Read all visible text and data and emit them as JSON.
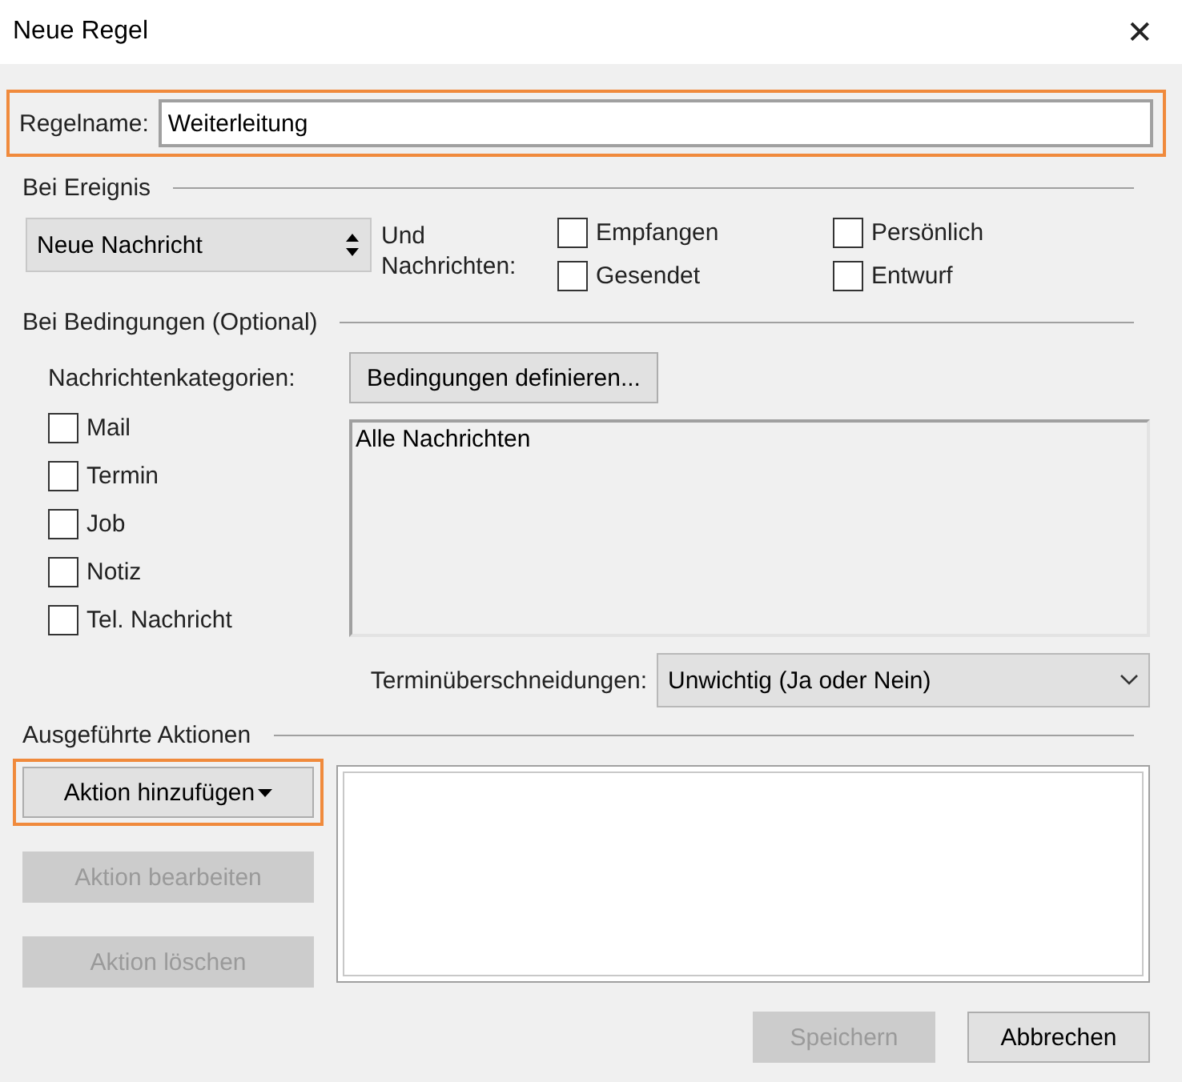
{
  "window": {
    "title": "Neue Regel",
    "close": "✕"
  },
  "rule_name": {
    "label": "Regelname:",
    "value": "Weiterleitung",
    "highlighted": true
  },
  "event": {
    "heading": "Bei Ereignis",
    "select": "Neue Nachricht",
    "label": "Und Nachrichten:",
    "checkboxes": [
      {
        "label": "Empfangen",
        "checked": false
      },
      {
        "label": "Persönlich",
        "checked": false
      },
      {
        "label": "Gesendet",
        "checked": false
      },
      {
        "label": "Entwurf",
        "checked": false
      }
    ]
  },
  "conditions": {
    "heading": "Bei Bedingungen  (Optional)",
    "categories_label": "Nachrichtenkategorien:",
    "define_button": "Bedingungen definieren...",
    "categories": [
      {
        "label": "Mail",
        "checked": false
      },
      {
        "label": "Termin",
        "checked": false
      },
      {
        "label": "Job",
        "checked": false
      },
      {
        "label": "Notiz",
        "checked": false
      },
      {
        "label": "Tel. Nachricht",
        "checked": false
      }
    ],
    "summary": "Alle Nachrichten",
    "overlap_label": "Terminüberschneidungen:",
    "overlap_value": "Unwichtig (Ja oder Nein)"
  },
  "actions": {
    "heading": "Ausgeführte Aktionen",
    "buttons": [
      {
        "label": "Aktion hinzufügen",
        "disabled": false,
        "highlighted": true,
        "dropdown": true
      },
      {
        "label": "Aktion bearbeiten",
        "disabled": true,
        "highlighted": false,
        "dropdown": false
      },
      {
        "label": "Aktion löschen",
        "disabled": true,
        "highlighted": false,
        "dropdown": false
      }
    ]
  },
  "footer": [
    {
      "label": "Speichern",
      "disabled": true
    },
    {
      "label": "Abbrechen",
      "disabled": false
    }
  ]
}
